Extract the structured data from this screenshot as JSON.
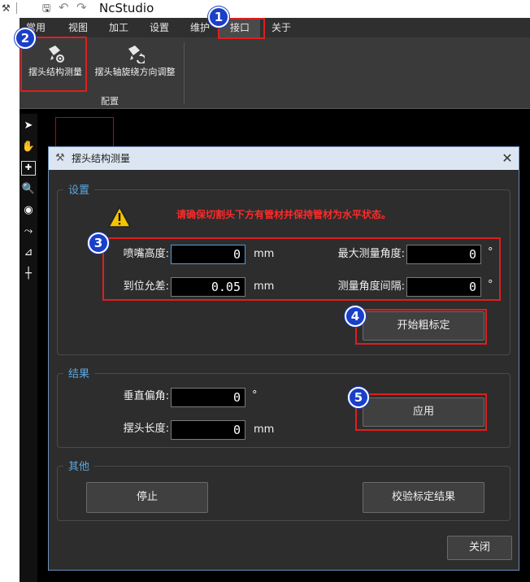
{
  "app": {
    "title": "NcStudio"
  },
  "menu": {
    "items": [
      {
        "label": "常用"
      },
      {
        "label": "视图"
      },
      {
        "label": "加工"
      },
      {
        "label": "设置"
      },
      {
        "label": "维护"
      },
      {
        "label": "接口"
      },
      {
        "label": "关于"
      }
    ]
  },
  "ribbon": {
    "buttons": [
      {
        "label": "摆头结构测量",
        "icon": "head-measure-icon"
      },
      {
        "label": "摆头轴旋绕方向调整",
        "icon": "head-rotate-icon"
      }
    ],
    "group_label": "配置"
  },
  "dialog": {
    "title": "摆头结构测量",
    "close_glyph": "✕",
    "settings": {
      "group_label": "设置",
      "warning": "请确保切割头下方有管材并保持管材为水平状态。",
      "nozzle_height": {
        "label": "喷嘴高度:",
        "value": "0",
        "unit": "mm"
      },
      "tolerance": {
        "label": "到位允差:",
        "value": "0.05",
        "unit": "mm"
      },
      "max_angle": {
        "label": "最大测量角度:",
        "value": "0",
        "unit": "°"
      },
      "angle_interval": {
        "label": "测量角度间隔:",
        "value": "0",
        "unit": "°"
      },
      "start_button": "开始粗标定"
    },
    "results": {
      "group_label": "结果",
      "vertical_offset": {
        "label": "垂直偏角:",
        "value": "0",
        "unit": "°"
      },
      "head_length": {
        "label": "摆头长度:",
        "value": "0",
        "unit": "mm"
      },
      "apply_button": "应用"
    },
    "other": {
      "group_label": "其他",
      "stop_button": "停止",
      "verify_button": "校验标定结果"
    },
    "close_button": "关闭"
  },
  "annotations": {
    "badges": [
      "1",
      "2",
      "3",
      "4",
      "5"
    ],
    "highlight_color": "#e01e1e",
    "badge_color": "#1a3fc8"
  }
}
